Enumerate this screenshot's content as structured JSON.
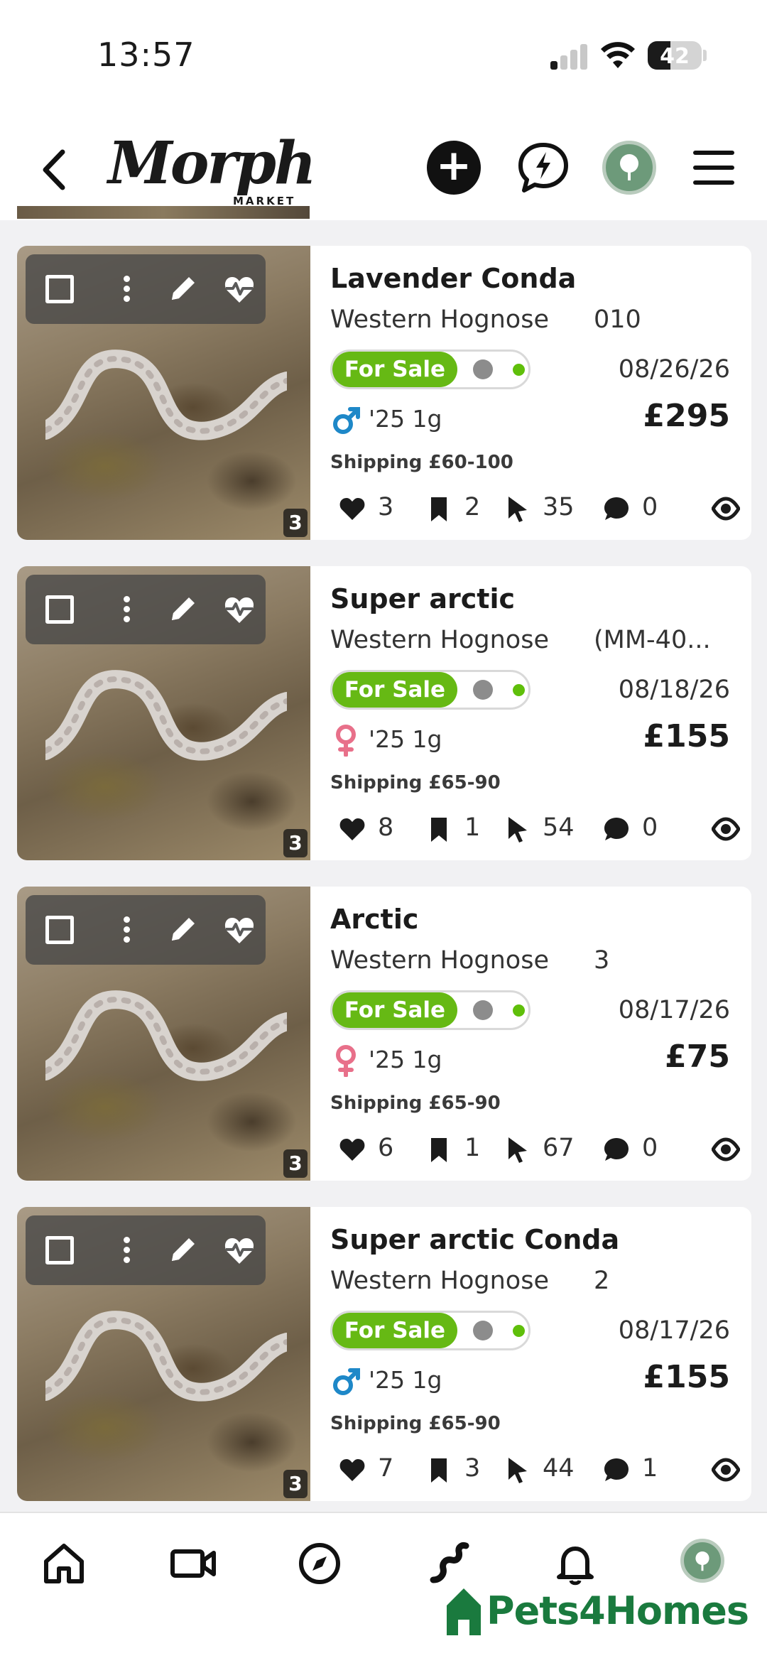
{
  "status_bar": {
    "time": "13:57",
    "battery": "42"
  },
  "header": {
    "logo_text": "Morph",
    "logo_sub": "MARKET"
  },
  "listings": [
    {
      "title": "Lavender Conda",
      "species": "Western Hognose",
      "code": "010",
      "status": "For Sale",
      "date": "08/26/26",
      "sex": "male",
      "age": "'25 1g",
      "price": "£295",
      "shipping": "Shipping £60-100",
      "likes": "3",
      "saves": "2",
      "clicks": "35",
      "messages": "0",
      "image_count": "3"
    },
    {
      "title": "Super arctic",
      "species": "Western Hognose",
      "code": "(MM-40...",
      "status": "For Sale",
      "date": "08/18/26",
      "sex": "female",
      "age": "'25 1g",
      "price": "£155",
      "shipping": "Shipping £65-90",
      "likes": "8",
      "saves": "1",
      "clicks": "54",
      "messages": "0",
      "image_count": "3"
    },
    {
      "title": "Arctic",
      "species": "Western Hognose",
      "code": "3",
      "status": "For Sale",
      "date": "08/17/26",
      "sex": "female",
      "age": "'25 1g",
      "price": "£75",
      "shipping": "Shipping £65-90",
      "likes": "6",
      "saves": "1",
      "clicks": "67",
      "messages": "0",
      "image_count": "3"
    },
    {
      "title": "Super arctic Conda",
      "species": "Western Hognose",
      "code": "2",
      "status": "For Sale",
      "date": "08/17/26",
      "sex": "male",
      "age": "'25 1g",
      "price": "£155",
      "shipping": "Shipping £65-90",
      "likes": "7",
      "saves": "3",
      "clicks": "44",
      "messages": "1",
      "image_count": "3"
    }
  ],
  "bottom_nav": {
    "icons": [
      "home-icon",
      "video-icon",
      "compass-icon",
      "snake-icon",
      "bell-icon",
      "avatar"
    ],
    "watermark": "Pets4Homes"
  },
  "colors": {
    "for_sale_green": "#66b914",
    "male_blue": "#1e88c8",
    "female_pink": "#e8708a",
    "brand_green": "#1a7a3e"
  }
}
